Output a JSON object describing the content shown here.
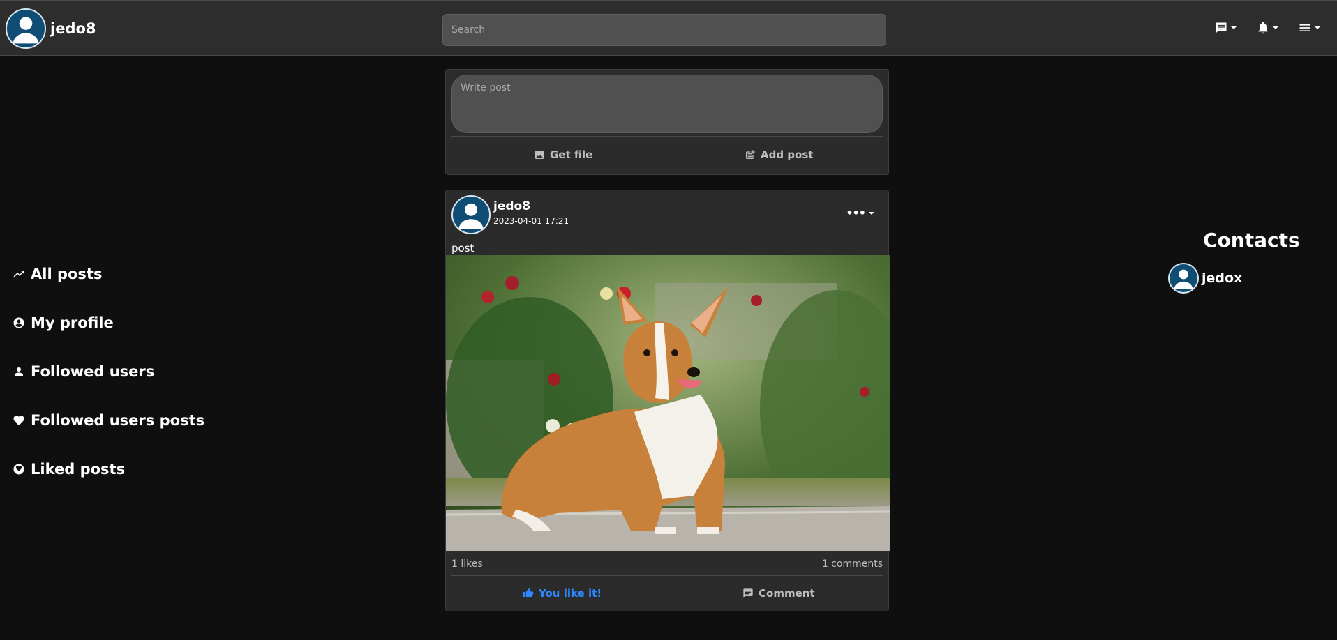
{
  "navbar": {
    "username": "jedo8",
    "search_placeholder": "Search",
    "icons": [
      "message-icon",
      "bell-icon",
      "menu-icon"
    ]
  },
  "sidebar": {
    "items": [
      {
        "label": "All posts",
        "icon": "trending-icon"
      },
      {
        "label": "My profile",
        "icon": "profile-icon"
      },
      {
        "label": "Followed users",
        "icon": "user-icon"
      },
      {
        "label": "Followed users posts",
        "icon": "heart-icon"
      },
      {
        "label": "Liked posts",
        "icon": "liked-icon"
      }
    ]
  },
  "composer": {
    "placeholder": "Write post",
    "get_file_label": "Get file",
    "add_post_label": "Add post"
  },
  "post": {
    "author": "jedo8",
    "date": "2023-04-01 17:21",
    "text": "post",
    "image_description": "corgi photo",
    "likes": "1 likes",
    "comments": "1 comments",
    "like_label": "You like it!",
    "comment_label": "Comment"
  },
  "contacts": {
    "title": "Contacts",
    "items": [
      {
        "name": "jedox"
      }
    ]
  },
  "colors": {
    "background": "#0f0f0f",
    "navbar": "#2d2d2d",
    "card": "#2b2b2b",
    "input": "#505050",
    "accent": "#2d88ff",
    "avatar": "#0f4d74"
  }
}
